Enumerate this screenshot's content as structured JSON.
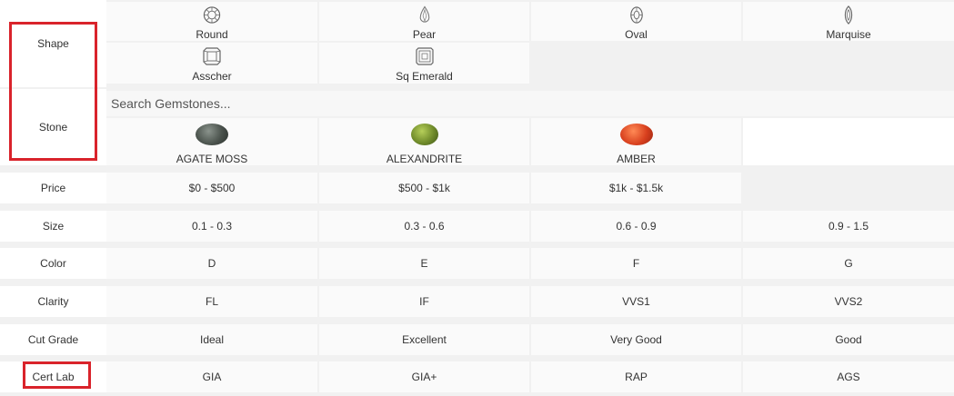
{
  "labels": {
    "shape": "Shape",
    "stone": "Stone",
    "price": "Price",
    "size": "Size",
    "color": "Color",
    "clarity": "Clarity",
    "cut_grade": "Cut Grade",
    "cert_lab": "Cert Lab"
  },
  "shapes": [
    {
      "label": "Round",
      "icon": "round-diamond-icon"
    },
    {
      "label": "Pear",
      "icon": "pear-diamond-icon"
    },
    {
      "label": "Oval",
      "icon": "oval-diamond-icon"
    },
    {
      "label": "Marquise",
      "icon": "marquise-diamond-icon"
    },
    {
      "label": "Asscher",
      "icon": "asscher-diamond-icon"
    },
    {
      "label": "Sq Emerald",
      "icon": "sq-emerald-diamond-icon"
    }
  ],
  "search": {
    "placeholder": "Search Gemstones..."
  },
  "stones": [
    {
      "label": "AGATE MOSS",
      "color": "#4a524c"
    },
    {
      "label": "ALEXANDRITE",
      "color": "#6f8a2a"
    },
    {
      "label": "AMBER",
      "color": "#d8401e"
    }
  ],
  "price": [
    "$0 - $500",
    "$500 - $1k",
    "$1k - $1.5k"
  ],
  "size": [
    "0.1 - 0.3",
    "0.3 - 0.6",
    "0.6 - 0.9",
    "0.9 - 1.5"
  ],
  "color": [
    "D",
    "E",
    "F",
    "G"
  ],
  "clarity": [
    "FL",
    "IF",
    "VVS1",
    "VVS2"
  ],
  "cut_grade": [
    "Ideal",
    "Excellent",
    "Very Good",
    "Good"
  ],
  "cert_lab": [
    "GIA",
    "GIA+",
    "RAP",
    "AGS"
  ],
  "highlight_color": "#d9232b"
}
